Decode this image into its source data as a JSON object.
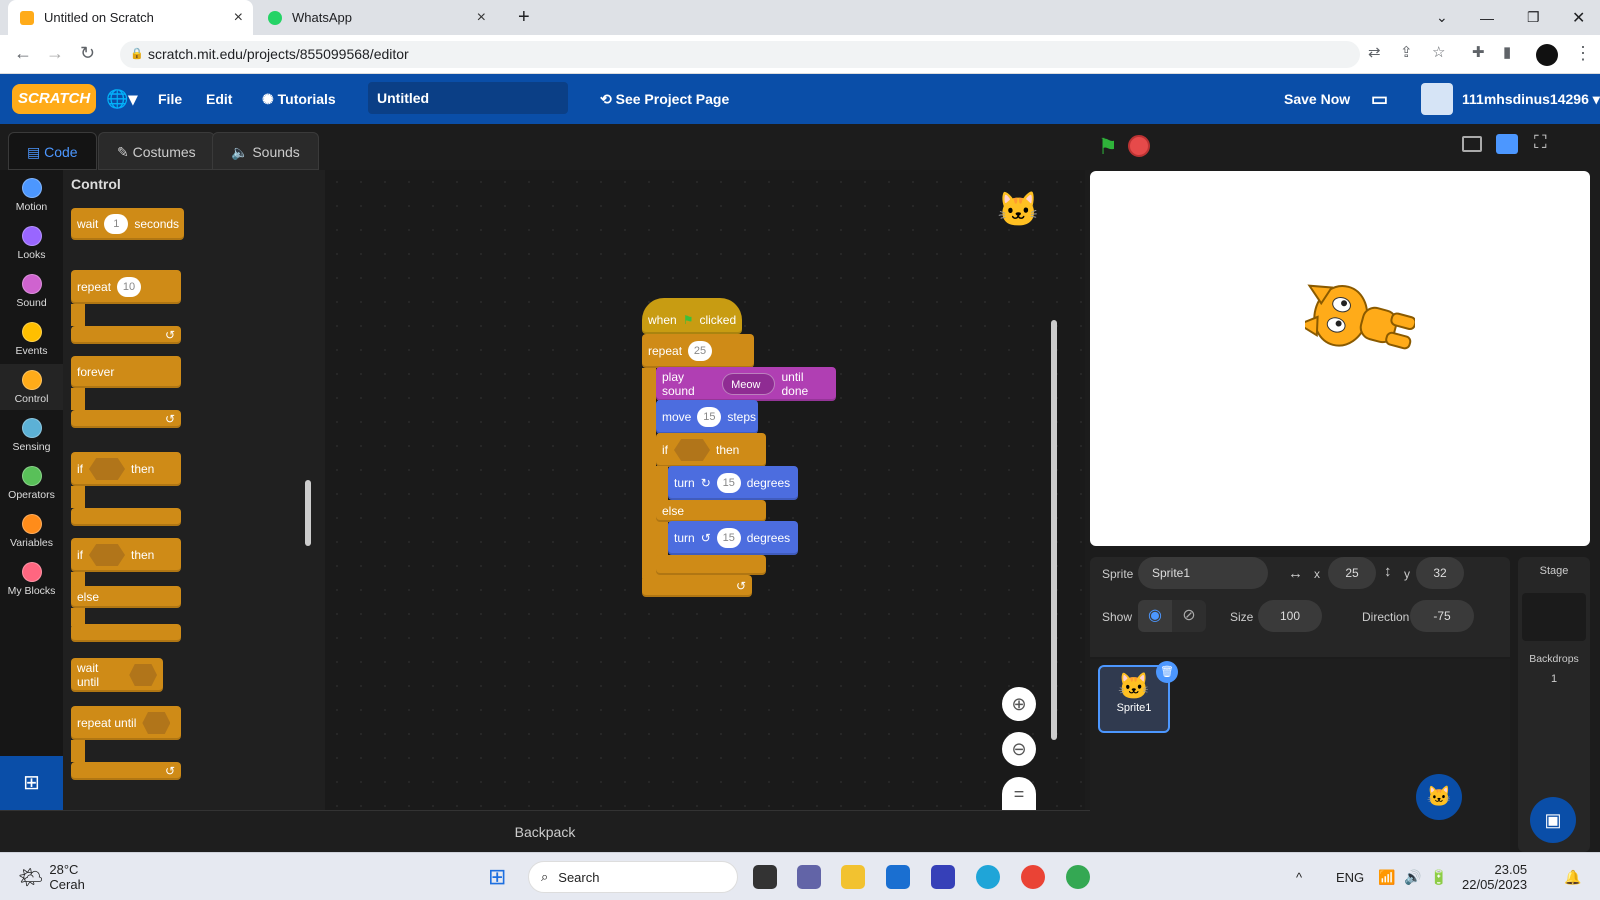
{
  "browser": {
    "tabs": [
      {
        "label": "Untitled on Scratch",
        "active": true
      },
      {
        "label": "WhatsApp",
        "active": false
      }
    ],
    "url": "scratch.mit.edu/projects/855099568/editor"
  },
  "menu": {
    "logo": "SCRATCH",
    "file": "File",
    "edit": "Edit",
    "tutorials": "Tutorials",
    "project_title": "Untitled",
    "see_project_page": "See Project Page",
    "save_now": "Save Now",
    "username": "111mhsdinus14296"
  },
  "editor_tabs": [
    "Code",
    "Costumes",
    "Sounds"
  ],
  "categories": [
    {
      "label": "Motion",
      "color": "#4c97ff"
    },
    {
      "label": "Looks",
      "color": "#9966ff"
    },
    {
      "label": "Sound",
      "color": "#cf63cf"
    },
    {
      "label": "Events",
      "color": "#ffbf00"
    },
    {
      "label": "Control",
      "color": "#ffab19"
    },
    {
      "label": "Sensing",
      "color": "#5cb1d6"
    },
    {
      "label": "Operators",
      "color": "#59c059"
    },
    {
      "label": "Variables",
      "color": "#ff8c1a"
    },
    {
      "label": "My Blocks",
      "color": "#ff6680"
    }
  ],
  "palette": {
    "heading": "Control",
    "wait": "wait",
    "wait_val": "1",
    "seconds": "seconds",
    "repeat": "repeat",
    "repeat_val": "10",
    "forever": "forever",
    "if": "if",
    "then": "then",
    "else": "else",
    "wait_until": "wait until",
    "repeat_until": "repeat until"
  },
  "script": {
    "when": "when",
    "clicked": "clicked",
    "repeat": "repeat",
    "repeat_val": "25",
    "play_sound": "play sound",
    "sound_name": "Meow",
    "until_done": "until done",
    "move": "move",
    "move_val": "15",
    "steps": "steps",
    "if": "if",
    "then": "then",
    "else": "else",
    "turn": "turn",
    "turn_right_val": "15",
    "turn_left_val": "15",
    "degrees": "degrees"
  },
  "backpack": "Backpack",
  "sprite_info": {
    "sprite_label": "Sprite",
    "sprite_name": "Sprite1",
    "x_label": "x",
    "x": "25",
    "y_label": "y",
    "y": "32",
    "show_label": "Show",
    "size_label": "Size",
    "size": "100",
    "direction_label": "Direction",
    "direction": "-75"
  },
  "sprite_tile": "Sprite1",
  "stage_pane": {
    "title": "Stage",
    "backdrops_label": "Backdrops",
    "backdrops_count": "1"
  },
  "taskbar": {
    "weather_temp": "28°C",
    "weather_text": "Cerah",
    "search": "Search",
    "lang": "ENG",
    "time": "23.05",
    "date": "22/05/2023"
  },
  "colors": {
    "scratch_blue": "#0a4ea8",
    "control": "#cf8b17",
    "motion": "#4c6ddf",
    "sound": "#b03fb3"
  }
}
